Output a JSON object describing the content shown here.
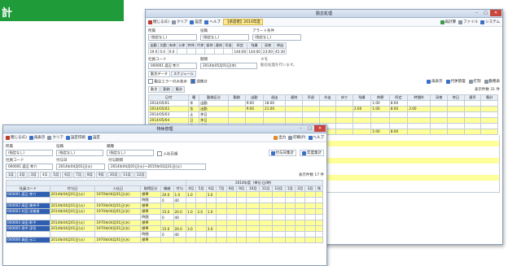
{
  "banner": {
    "text": "計"
  },
  "back_window": {
    "title": "勤怠処理",
    "toolbar": {
      "left": [
        "閉じる(E)",
        "クリア",
        "設定",
        "ヘルプ"
      ],
      "highlight": "【承認者】2014年度",
      "right": [
        "再計算",
        "ファイル",
        "システム"
      ]
    },
    "filter_labels": [
      "所属",
      "役職",
      "アラート条件"
    ],
    "filter_values": [
      "(指定なし)",
      "(指定なし)",
      "(指定なし)"
    ],
    "summary_headers": [
      "出勤",
      "欠勤",
      "有休",
      "公休",
      "特休",
      "代休",
      "振休",
      "遅刻",
      "早退",
      "所定",
      "残業",
      "深夜",
      "休出"
    ],
    "summary_values": [
      "19.0",
      "0.0",
      "0.0",
      "",
      "",
      "",
      "",
      "",
      "",
      "144:00",
      "144:00",
      "23:00",
      "45:30"
    ],
    "employee": {
      "code_label": "社員コード",
      "code": "000001 渡辺 孝介",
      "period_label": "期間",
      "period": "2014年05月01日(木)",
      "memo_label": "メモ",
      "memo": "勤怠処理を行います。"
    },
    "section_tabs": [
      "勤怠データ",
      "スケジュール"
    ],
    "checks": [
      "勤怠エラーのみ表示",
      "週集計"
    ],
    "right_buttons": [
      "再表示",
      "代休管理",
      "打刻",
      "勤務表"
    ],
    "count_label": "表示件数 31 件",
    "grid_tabs": [
      "勤怠",
      "勤務",
      "集計"
    ],
    "headers": [
      "日付",
      "曜",
      "勤務区分",
      "勤務",
      "出勤",
      "退出",
      "遅刻",
      "早退",
      "外出",
      "戻り",
      "残業",
      "休憩",
      "所定",
      "時間外",
      "深夜",
      "休日",
      "遅早",
      "集計"
    ],
    "rows": [
      [
        "2014/05/01",
        "木",
        "出勤",
        "",
        "9:00",
        "18:00",
        "",
        "",
        "",
        "",
        "",
        "1:00",
        "8:00",
        "",
        "",
        "",
        "",
        ""
      ],
      [
        "2014/05/02",
        "金",
        "出勤",
        "",
        "9:00",
        "21:00",
        "",
        "",
        "",
        "",
        "2:00",
        "1:00",
        "8:00",
        "2:00",
        "",
        "",
        "",
        ""
      ],
      [
        "2014/05/03",
        "土",
        "休日",
        "",
        "",
        "",
        "",
        "",
        "",
        "",
        "",
        "",
        "",
        "",
        "",
        "",
        "",
        ""
      ],
      [
        "2014/05/04",
        "日",
        "休日",
        "",
        "",
        "",
        "",
        "",
        "",
        "",
        "",
        "",
        "",
        "",
        "",
        "",
        "",
        ""
      ],
      [
        "2014/05/05",
        "月",
        "祝日",
        "",
        "",
        "",
        "",
        "",
        "",
        "",
        "",
        "",
        "",
        "",
        "",
        "",
        "",
        ""
      ],
      [
        "2014/05/06",
        "火",
        "出勤",
        "",
        "9:00",
        "18:00",
        "",
        "",
        "",
        "",
        "",
        "1:00",
        "8:00",
        "",
        "",
        "",
        "",
        ""
      ]
    ]
  },
  "front_window": {
    "title": "特休管理",
    "toolbar": [
      "閉じる(E)",
      "再表示",
      "クリア",
      "設定印刷",
      "設定"
    ],
    "toolbar_right": [
      "出力",
      "印刷(P)",
      "ヘルプ",
      "付与日集計",
      "年度集計"
    ],
    "filter_labels": [
      "所属",
      "役職",
      "職種"
    ],
    "filter_values": [
      "(指定なし)",
      "(指定なし)",
      "(指定なし)"
    ],
    "retired_label": "入社日順",
    "staff_label": "社員コード",
    "staff_value": "000001 渡辺 孝介",
    "grant_label": "付与日",
    "grant_value": "2014年04月01日(火)",
    "period_label": "付与期間",
    "period_value": "2014年04月01日(火)～2015年03月31日(火)",
    "months": [
      "1月",
      "2月",
      "3月",
      "4月",
      "5月",
      "6月",
      "7月",
      "8月",
      "9月",
      "10月",
      "11月",
      "12月"
    ],
    "count_label": "表示件数 17 件",
    "year_header": "2014年度（単位:日/時）",
    "headers": [
      "社員コード",
      "付与日",
      "入社日",
      "取得区分",
      "繰越",
      "付与",
      "4月",
      "5月",
      "6月",
      "7月",
      "8月",
      "9月",
      "10月",
      "11月",
      "12月",
      "1月",
      "2月",
      "3月",
      "残"
    ],
    "rows": [
      {
        "code": "000001 渡辺 孝介",
        "grant": "2014年04月01日(火)",
        "join": "1970年04月01日(水)",
        "kind": "標準",
        "carry": "20.0",
        "give": "1.0",
        "m4": "1.0",
        "m5": "",
        "m6": "3.0",
        "hl": true
      },
      {
        "code": "",
        "grant": "",
        "join": "",
        "kind": "時間",
        "carry": "0",
        "give": "40",
        "m4": "",
        "m5": "",
        "m6": "",
        "hl": false
      },
      {
        "code": "000002 高田 美奈子",
        "grant": "2014年04月01日(火)",
        "join": "1970年04月01日(水)",
        "kind": "標準",
        "carry": "",
        "give": "",
        "m4": "",
        "m5": "",
        "m6": "",
        "hl": true
      },
      {
        "code": "000003 村田 深美香",
        "grant": "2014年04月01日(火)",
        "join": "1970年04月01日(水)",
        "kind": "標準",
        "carry": "15.0",
        "give": "20.0",
        "m4": "1.0",
        "m5": "2.0",
        "m6": "1.0",
        "hl": true
      },
      {
        "code": "",
        "grant": "",
        "join": "",
        "kind": "時間",
        "carry": "0",
        "give": "40",
        "m4": "",
        "m5": "",
        "m6": "",
        "hl": false
      },
      {
        "code": "000004 深田 彰子",
        "grant": "2014年04月01日(火)",
        "join": "1970年04月01日(水)",
        "kind": "標準",
        "carry": "",
        "give": "",
        "m4": "",
        "m5": "",
        "m6": "",
        "hl": true
      },
      {
        "code": "000005 寿中 淳司",
        "grant": "2014年04月01日(火)",
        "join": "1970年04月01日(水)",
        "kind": "標準",
        "carry": "15.0",
        "give": "20.0",
        "m4": "3.0",
        "m5": "",
        "m6": "3.0",
        "hl": true
      },
      {
        "code": "",
        "grant": "",
        "join": "",
        "kind": "時間",
        "carry": "0",
        "give": "40",
        "m4": "",
        "m5": "",
        "m6": "",
        "hl": false
      },
      {
        "code": "000006 森田 元二",
        "grant": "2014年04月01日(火)",
        "join": "1970年04月01日(水)",
        "kind": "標準",
        "carry": "",
        "give": "",
        "m4": "",
        "m5": "",
        "m6": "",
        "hl": true
      }
    ]
  },
  "colors": {
    "banner": "#1f9b3a",
    "highlight_row": "#ffff99",
    "selected_cell": "#2f5fb0",
    "close_button": "#c9463d"
  }
}
